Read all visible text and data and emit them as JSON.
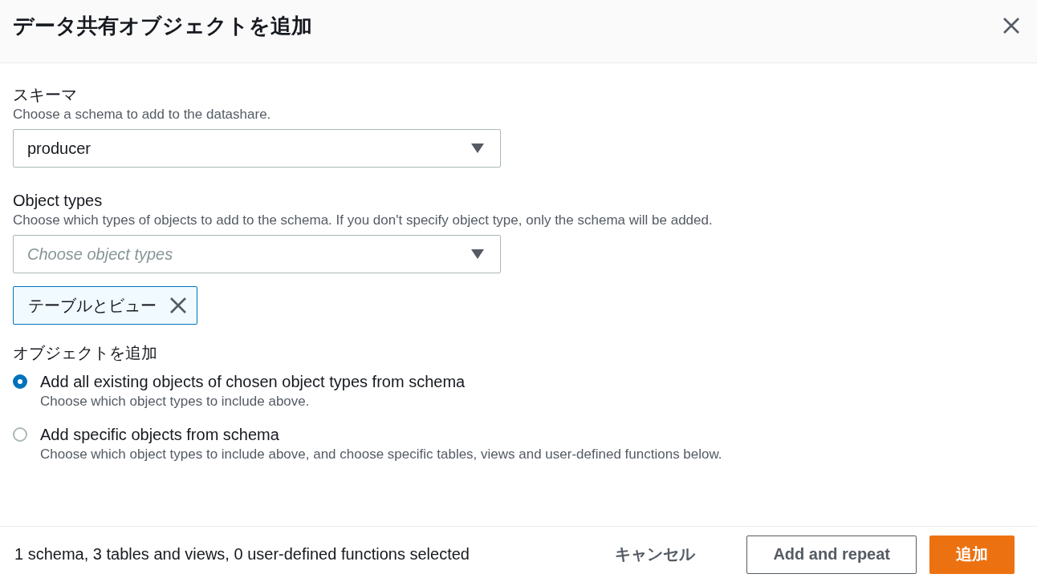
{
  "dialog": {
    "title": "データ共有オブジェクトを追加"
  },
  "schema_field": {
    "label": "スキーマ",
    "description": "Choose a schema to add to the datashare.",
    "value": "producer"
  },
  "object_types_field": {
    "label": "Object types",
    "description": "Choose which types of objects to add to the schema. If you don't specify object type, only the schema will be added.",
    "placeholder": "Choose object types",
    "tokens": [
      {
        "label": "テーブルとビュー"
      }
    ]
  },
  "add_objects": {
    "label": "オブジェクトを追加",
    "options": [
      {
        "label": "Add all existing objects of chosen object types from schema",
        "description": "Choose which object types to include above.",
        "selected": true
      },
      {
        "label": "Add specific objects from schema",
        "description": "Choose which object types to include above, and choose specific tables, views and user-defined functions below.",
        "selected": false
      }
    ]
  },
  "footer": {
    "summary": "1 schema, 3 tables and views, 0 user-defined functions selected",
    "buttons": [
      {
        "label": "キャンセル",
        "kind": "link"
      },
      {
        "label": "Add and repeat",
        "kind": "normal"
      },
      {
        "label": "追加",
        "kind": "primary"
      }
    ]
  }
}
